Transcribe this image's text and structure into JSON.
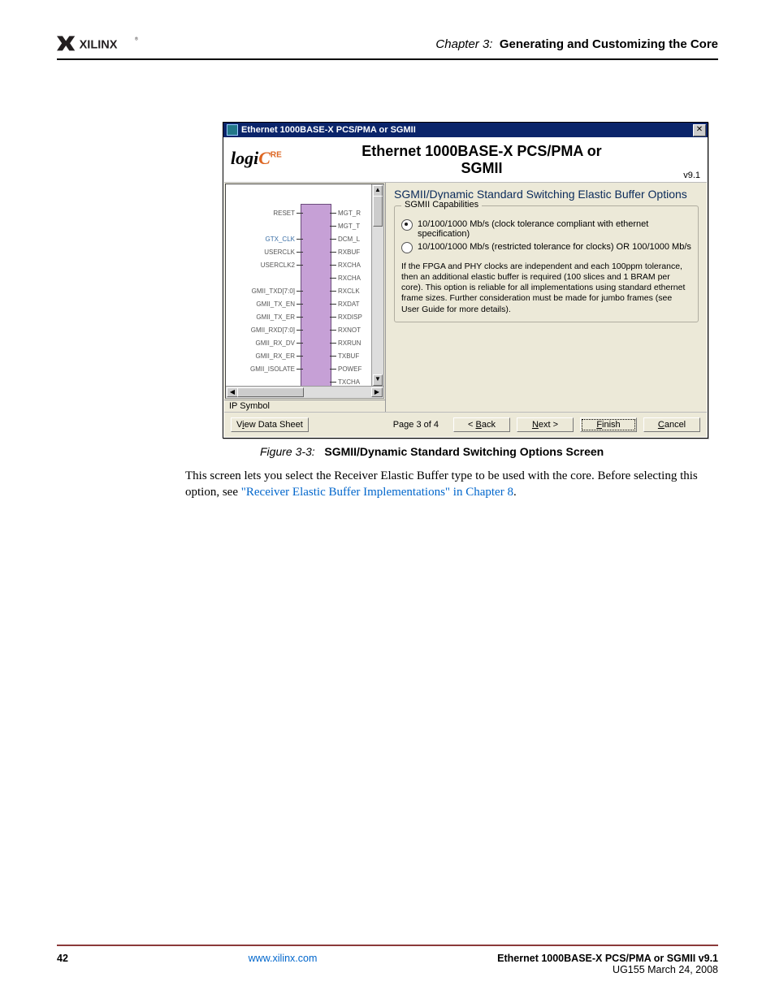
{
  "header": {
    "chapter_prefix": "Chapter 3:",
    "chapter_title": "Generating and Customizing the Core"
  },
  "window": {
    "titlebar": "Ethernet 1000BASE-X PCS/PMA or SGMII",
    "banner_logo_text_1": "logi",
    "banner_logo_text_2": "C",
    "banner_logo_text_3": "RE",
    "banner_title_line1": "Ethernet 1000BASE-X PCS/PMA or",
    "banner_title_line2": "SGMII",
    "version": "v9.1",
    "ip_symbol_tab": "IP Symbol",
    "ports_left": [
      {
        "name": "RESET",
        "blue": false
      },
      {
        "name": "",
        "blue": false
      },
      {
        "name": "GTX_CLK",
        "blue": true
      },
      {
        "name": "USERCLK",
        "blue": false
      },
      {
        "name": "USERCLK2",
        "blue": false
      },
      {
        "name": "",
        "blue": false
      },
      {
        "name": "GMII_TXD[7:0]",
        "blue": false
      },
      {
        "name": "GMII_TX_EN",
        "blue": false
      },
      {
        "name": "GMII_TX_ER",
        "blue": false
      },
      {
        "name": "GMII_RXD[7:0]",
        "blue": false
      },
      {
        "name": "GMII_RX_DV",
        "blue": false
      },
      {
        "name": "GMII_RX_ER",
        "blue": false
      },
      {
        "name": "GMII_ISOLATE",
        "blue": false
      }
    ],
    "ports_right": [
      "MGT_R",
      "MGT_T",
      "DCM_L",
      "RXBUF",
      "RXCHA",
      "RXCHA",
      "RXCLK",
      "RXDAT",
      "RXDISP",
      "RXNOT",
      "RXRUN",
      "TXBUF",
      "POWEF",
      "TXCHA"
    ],
    "options": {
      "panel_title": "SGMII/Dynamic Standard Switching Elastic Buffer Options",
      "group_legend": "SGMII Capabilities",
      "radio1": "10/100/1000 Mb/s (clock tolerance compliant with ethernet specification)",
      "radio2": "10/100/1000 Mb/s (restricted tolerance for clocks) OR 100/1000 Mb/s",
      "note": "If the FPGA and PHY clocks are independent and each 100ppm tolerance, then an additional elastic buffer is required (100 slices and 1 BRAM per core).  This option is reliable for all implementations using standard ethernet frame sizes. Further consideration must be made for jumbo frames (see User Guide for more details)."
    },
    "buttons": {
      "view_datasheet_pre": "V",
      "view_datasheet_u": "i",
      "view_datasheet_post": "ew Data Sheet",
      "page_info": "Page 3 of 4",
      "back_pre": "< ",
      "back_u": "B",
      "back_post": "ack",
      "next_u": "N",
      "next_post": "ext >",
      "finish_u": "F",
      "finish_post": "inish",
      "cancel_u": "C",
      "cancel_post": "ancel"
    }
  },
  "figure": {
    "label": "Figure 3-3:",
    "caption": "SGMII/Dynamic Standard Switching Options Screen"
  },
  "paragraph": {
    "part1": "This screen lets you select the Receiver Elastic Buffer type to be used with the core. Before selecting this option, see ",
    "link": "\"Receiver Elastic Buffer Implementations\" in Chapter 8",
    "part2": "."
  },
  "footer": {
    "page_number": "42",
    "url_text": "www.xilinx.com",
    "doc_title": "Ethernet 1000BASE-X PCS/PMA or SGMII v9.1",
    "doc_id": "UG155 March 24, 2008"
  }
}
